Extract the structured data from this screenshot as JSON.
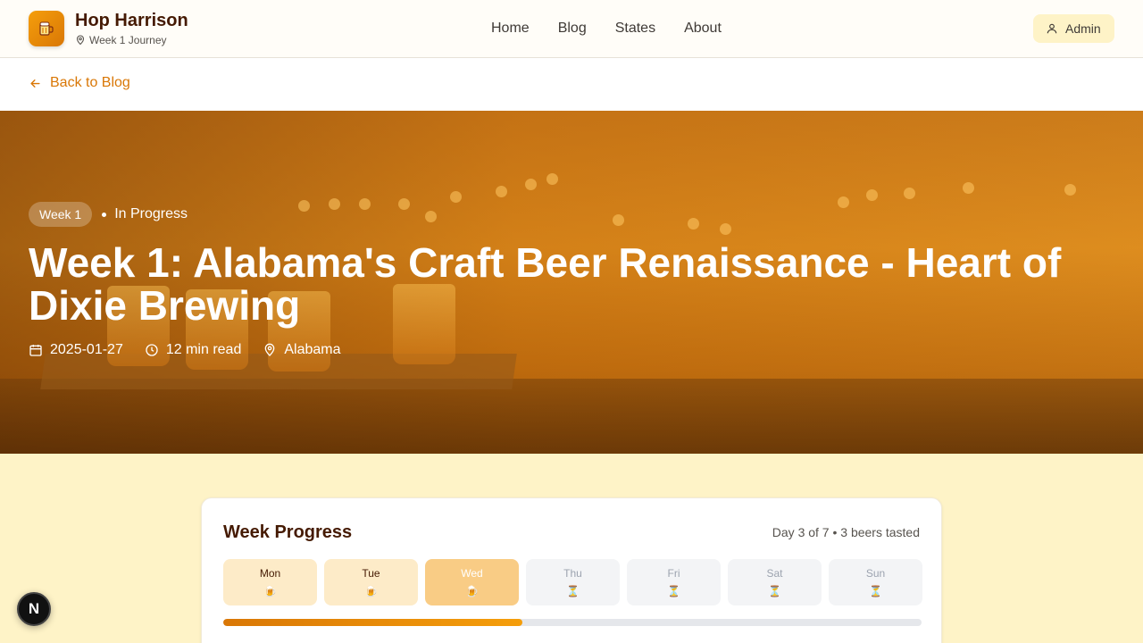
{
  "header": {
    "brand_title": "Hop Harrison",
    "brand_subtitle": "Week 1 Journey",
    "logo_icon": "beer-mug-icon",
    "nav": [
      {
        "label": "Home"
      },
      {
        "label": "Blog"
      },
      {
        "label": "States"
      },
      {
        "label": "About"
      }
    ],
    "admin_label": "Admin"
  },
  "back_link": "Back to Blog",
  "hero": {
    "week_badge": "Week 1",
    "status": "In Progress",
    "title": "Week 1: Alabama's Craft Beer Renaissance - Heart of Dixie Brewing",
    "date": "2025-01-27",
    "read_time": "12 min read",
    "location": "Alabama"
  },
  "progress": {
    "title": "Week Progress",
    "summary": "Day 3 of 7 • 3 beers tasted",
    "fraction": 0.4286,
    "days": [
      {
        "label": "Mon",
        "state": "done",
        "icon": "🍺"
      },
      {
        "label": "Tue",
        "state": "done",
        "icon": "🍺"
      },
      {
        "label": "Wed",
        "state": "current",
        "icon": "🍺"
      },
      {
        "label": "Thu",
        "state": "future",
        "icon": "⏳"
      },
      {
        "label": "Fri",
        "state": "future",
        "icon": "⏳"
      },
      {
        "label": "Sat",
        "state": "future",
        "icon": "⏳"
      },
      {
        "label": "Sun",
        "state": "future",
        "icon": "⏳"
      }
    ]
  },
  "floating_badge": "N",
  "colors": {
    "accent": "#d97706",
    "accent_light": "#f59e0b",
    "page_bg": "#fef3c7",
    "text_dark": "#451a03"
  }
}
